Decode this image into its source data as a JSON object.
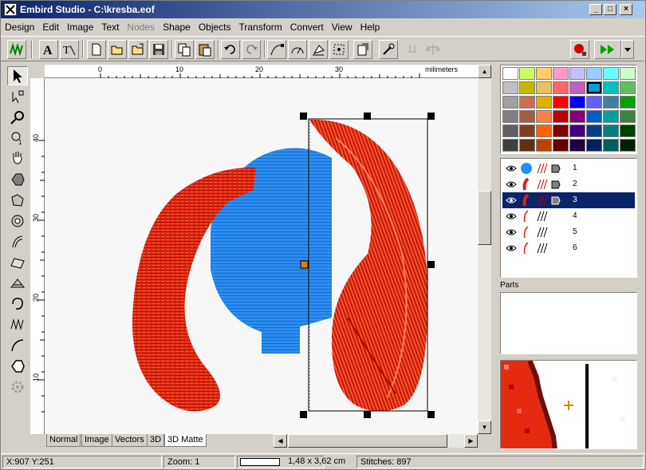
{
  "window": {
    "title": "Embird Studio - C:\\kresba.eof",
    "minimize": "_",
    "maximize": "□",
    "close": "×"
  },
  "menu": [
    "Design",
    "Edit",
    "Image",
    "Text",
    "Nodes",
    "Shape",
    "Objects",
    "Transform",
    "Convert",
    "View",
    "Help"
  ],
  "ruler": {
    "unit": "milimeters",
    "top_ticks": [
      "0",
      "10",
      "20",
      "30"
    ],
    "left_ticks": [
      "40",
      "30",
      "20",
      "10"
    ]
  },
  "tabs": [
    "Normal",
    "Image",
    "Vectors",
    "3D",
    "3D Matte"
  ],
  "active_tab": "3D Matte",
  "palette": {
    "colors": [
      "#ffffff",
      "#ccff66",
      "#ffcc66",
      "#ff99cc",
      "#c0c0ff",
      "#99ccff",
      "#66ffff",
      "#ccffcc",
      "#c0c0c0",
      "#c8b400",
      "#e8c060",
      "#ff6666",
      "#c060c0",
      "#00a0e0",
      "#00c0c0",
      "#60c060",
      "#a0a0a0",
      "#c87050",
      "#e0b000",
      "#ff0000",
      "#0000ff",
      "#6060ff",
      "#4080a0",
      "#00a000",
      "#808080",
      "#a06040",
      "#ff8040",
      "#c00000",
      "#800080",
      "#0060c0",
      "#00a0a0",
      "#408040",
      "#606060",
      "#804020",
      "#ff6000",
      "#800000",
      "#400080",
      "#004080",
      "#008080",
      "#004000",
      "#404040",
      "#603010",
      "#c04000",
      "#600000",
      "#200040",
      "#002060",
      "#006060",
      "#002000"
    ],
    "selected_index": 13
  },
  "objects": [
    {
      "number": "1",
      "color": "#1e90ff",
      "selected": false
    },
    {
      "number": "2",
      "color": "#e02010",
      "selected": false
    },
    {
      "number": "3",
      "color": "#e02010",
      "selected": true
    },
    {
      "number": "4",
      "color": "#e02010",
      "selected": false
    },
    {
      "number": "5",
      "color": "#e02010",
      "selected": false
    },
    {
      "number": "6",
      "color": "#e02010",
      "selected": false
    }
  ],
  "parts_label": "Parts",
  "status": {
    "coords": "X:907  Y:251",
    "zoom": "Zoom: 1",
    "size": "1,48 x 3,62 cm",
    "stitches": "Stitches: 897"
  }
}
